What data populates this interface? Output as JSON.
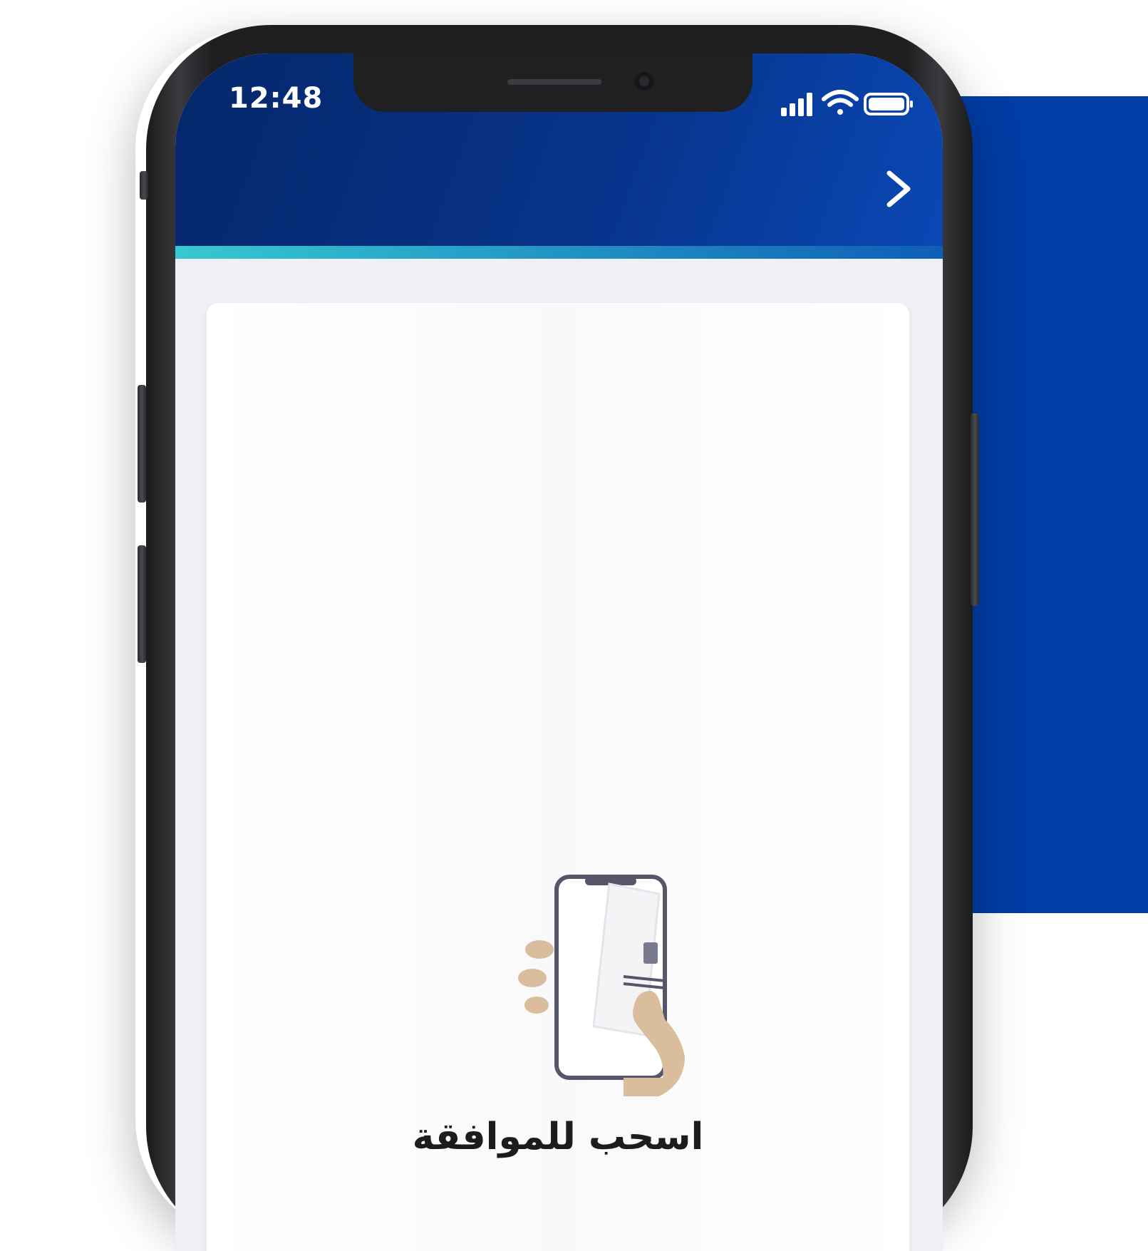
{
  "status_bar": {
    "time": "12:48",
    "icons": [
      "signal-icon",
      "wifi-icon",
      "battery-icon"
    ]
  },
  "header": {
    "back_icon": "chevron-right-icon"
  },
  "card": {
    "illustration_icon": "hand-holding-phone-icon",
    "swipe_label": "اسحب للموافقة"
  },
  "colors": {
    "brand_blue": "#003da5",
    "header_dark": "#06276b",
    "accent_teal": "#36c9d1",
    "screen_bg": "#eef0f5"
  }
}
